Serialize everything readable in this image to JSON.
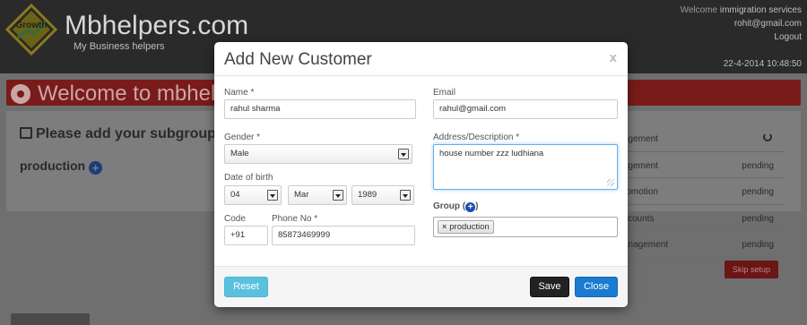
{
  "app": {
    "brand_title": "Mbhelpers.com",
    "brand_subtitle": "My Business helpers",
    "logo_text": "Growth",
    "welcome_label": "Welcome",
    "company": "immigration services",
    "user_email": "rohit@gmail.com",
    "logout": "Logout",
    "datetime": "22-4-2014 10:48:50",
    "welcome_banner": "Welcome to mbhel",
    "subgroups_prompt": "Please add your subgroups/",
    "group_name": "production",
    "tasks": [
      {
        "name": "agement",
        "status": ""
      },
      {
        "name": "agement",
        "status": "pending"
      },
      {
        "name": "romotion",
        "status": "pending"
      },
      {
        "name": "ccounts",
        "status": "pending"
      },
      {
        "name": "anagement",
        "status": "pending"
      }
    ],
    "skip_setup": "Skip setup"
  },
  "modal": {
    "title": "Add New Customer",
    "close_x": "x",
    "name_label": "Name *",
    "name_value": "rahul sharma",
    "email_label": "Email",
    "email_value": "rahul@gmail.com",
    "gender_label": "Gender *",
    "gender_value": "Male",
    "address_label": "Address/Description *",
    "address_value": "house number zzz ludhiana",
    "dob_label": "Date of birth",
    "dob_day": "04",
    "dob_month": "Mar",
    "dob_year": "1989",
    "group_label": "Group",
    "group_tags": [
      "production"
    ],
    "tag_remove": "×",
    "code_label": "Code",
    "code_value": "+91",
    "phone_label": "Phone No *",
    "phone_value": "85873469999",
    "reset_label": "Reset",
    "save_label": "Save",
    "close_label": "Close"
  },
  "colors": {
    "accent_blue": "#1a7bd0",
    "info_blue": "#5bc0de",
    "banner_red": "#7a1b1b"
  }
}
